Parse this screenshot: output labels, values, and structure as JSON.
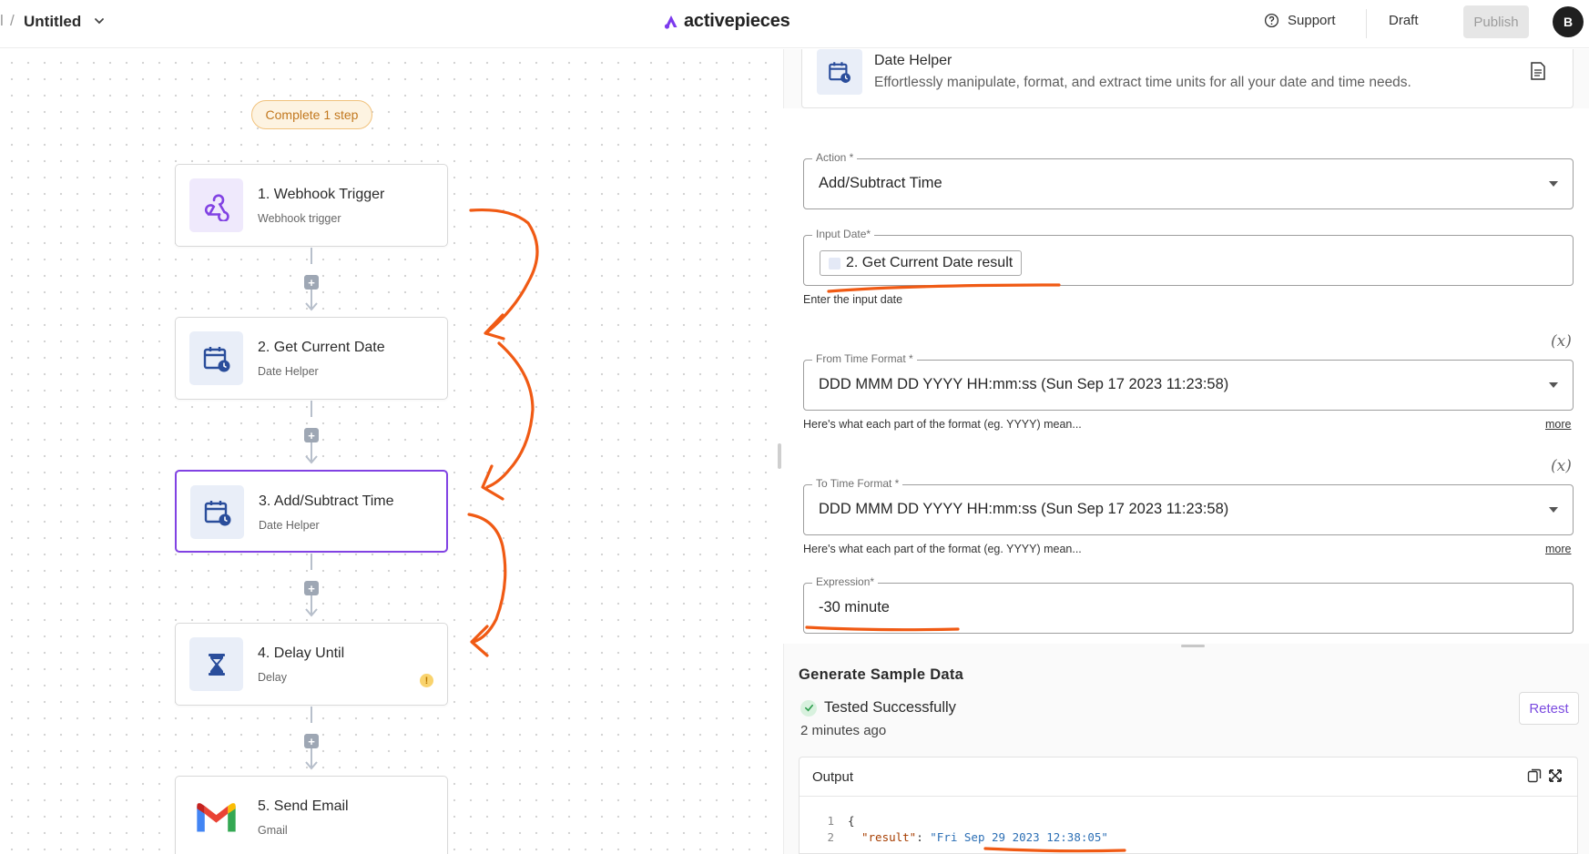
{
  "header": {
    "breadcrumb_edge": "l",
    "breadcrumb_slash": "/",
    "flow_title": "Untitled",
    "brand_name": "activepieces",
    "support_label": "Support",
    "draft_label": "Draft",
    "publish_label": "Publish",
    "avatar_initial": "B"
  },
  "canvas": {
    "complete_label": "Complete 1 step",
    "steps": [
      {
        "title": "1. Webhook Trigger",
        "subtitle": "Webhook trigger",
        "icon": "webhook-icon"
      },
      {
        "title": "2. Get Current Date",
        "subtitle": "Date Helper",
        "icon": "calendar-clock-icon"
      },
      {
        "title": "3. Add/Subtract Time",
        "subtitle": "Date Helper",
        "icon": "calendar-clock-icon",
        "active": true
      },
      {
        "title": "4. Delay Until",
        "subtitle": "Delay",
        "icon": "hourglass-icon",
        "warning": "!"
      },
      {
        "title": "5. Send Email",
        "subtitle": "Gmail",
        "icon": "gmail-icon"
      }
    ],
    "plus_symbol": "+"
  },
  "panel": {
    "piece_title": "Date Helper",
    "piece_description": "Effortlessly manipulate, format, and extract time units for all your date and time needs.",
    "action": {
      "label": "Action *",
      "value": "Add/Subtract Time"
    },
    "input_date": {
      "label": "Input Date*",
      "chip": "2. Get Current Date result",
      "help": "Enter the input date"
    },
    "from_format": {
      "label": "From Time Format *",
      "value": "DDD MMM DD YYYY HH:mm:ss (Sun Sep 17 2023 11:23:58)",
      "help": "Here's what each part of the format (eg. YYYY) mean...",
      "more": "more",
      "fx": "(x)"
    },
    "to_format": {
      "label": "To Time Format *",
      "value": "DDD MMM DD YYYY HH:mm:ss (Sun Sep 17 2023 11:23:58)",
      "help": "Here's what each part of the format (eg. YYYY) mean...",
      "more": "more",
      "fx": "(x)"
    },
    "expression": {
      "label": "Expression*",
      "value": "-30 minute"
    }
  },
  "sample": {
    "title": "Generate Sample Data",
    "status": "Tested Successfully",
    "time_ago": "2 minutes ago",
    "retest_label": "Retest",
    "output_label": "Output",
    "code_lines": [
      {
        "num": "1",
        "text": "{"
      },
      {
        "num": "2",
        "key": "\"result\"",
        "sep": ": ",
        "value": "\"Fri Sep 29 2023 12:38:05\""
      }
    ]
  },
  "colors": {
    "accent": "#8142e3",
    "annotation": "#f05a14",
    "warning": "#f9d36d",
    "success": "#2f9e4f"
  }
}
